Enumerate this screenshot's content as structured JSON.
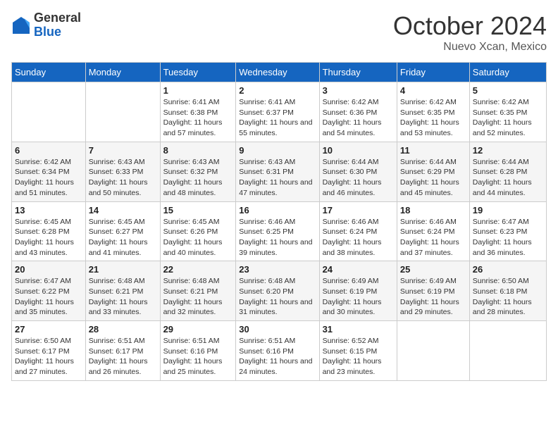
{
  "header": {
    "logo_general": "General",
    "logo_blue": "Blue",
    "month_title": "October 2024",
    "location": "Nuevo Xcan, Mexico"
  },
  "days_of_week": [
    "Sunday",
    "Monday",
    "Tuesday",
    "Wednesday",
    "Thursday",
    "Friday",
    "Saturday"
  ],
  "weeks": [
    [
      {
        "day": "",
        "info": ""
      },
      {
        "day": "",
        "info": ""
      },
      {
        "day": "1",
        "info": "Sunrise: 6:41 AM\nSunset: 6:38 PM\nDaylight: 11 hours and 57 minutes."
      },
      {
        "day": "2",
        "info": "Sunrise: 6:41 AM\nSunset: 6:37 PM\nDaylight: 11 hours and 55 minutes."
      },
      {
        "day": "3",
        "info": "Sunrise: 6:42 AM\nSunset: 6:36 PM\nDaylight: 11 hours and 54 minutes."
      },
      {
        "day": "4",
        "info": "Sunrise: 6:42 AM\nSunset: 6:35 PM\nDaylight: 11 hours and 53 minutes."
      },
      {
        "day": "5",
        "info": "Sunrise: 6:42 AM\nSunset: 6:35 PM\nDaylight: 11 hours and 52 minutes."
      }
    ],
    [
      {
        "day": "6",
        "info": "Sunrise: 6:42 AM\nSunset: 6:34 PM\nDaylight: 11 hours and 51 minutes."
      },
      {
        "day": "7",
        "info": "Sunrise: 6:43 AM\nSunset: 6:33 PM\nDaylight: 11 hours and 50 minutes."
      },
      {
        "day": "8",
        "info": "Sunrise: 6:43 AM\nSunset: 6:32 PM\nDaylight: 11 hours and 48 minutes."
      },
      {
        "day": "9",
        "info": "Sunrise: 6:43 AM\nSunset: 6:31 PM\nDaylight: 11 hours and 47 minutes."
      },
      {
        "day": "10",
        "info": "Sunrise: 6:44 AM\nSunset: 6:30 PM\nDaylight: 11 hours and 46 minutes."
      },
      {
        "day": "11",
        "info": "Sunrise: 6:44 AM\nSunset: 6:29 PM\nDaylight: 11 hours and 45 minutes."
      },
      {
        "day": "12",
        "info": "Sunrise: 6:44 AM\nSunset: 6:28 PM\nDaylight: 11 hours and 44 minutes."
      }
    ],
    [
      {
        "day": "13",
        "info": "Sunrise: 6:45 AM\nSunset: 6:28 PM\nDaylight: 11 hours and 43 minutes."
      },
      {
        "day": "14",
        "info": "Sunrise: 6:45 AM\nSunset: 6:27 PM\nDaylight: 11 hours and 41 minutes."
      },
      {
        "day": "15",
        "info": "Sunrise: 6:45 AM\nSunset: 6:26 PM\nDaylight: 11 hours and 40 minutes."
      },
      {
        "day": "16",
        "info": "Sunrise: 6:46 AM\nSunset: 6:25 PM\nDaylight: 11 hours and 39 minutes."
      },
      {
        "day": "17",
        "info": "Sunrise: 6:46 AM\nSunset: 6:24 PM\nDaylight: 11 hours and 38 minutes."
      },
      {
        "day": "18",
        "info": "Sunrise: 6:46 AM\nSunset: 6:24 PM\nDaylight: 11 hours and 37 minutes."
      },
      {
        "day": "19",
        "info": "Sunrise: 6:47 AM\nSunset: 6:23 PM\nDaylight: 11 hours and 36 minutes."
      }
    ],
    [
      {
        "day": "20",
        "info": "Sunrise: 6:47 AM\nSunset: 6:22 PM\nDaylight: 11 hours and 35 minutes."
      },
      {
        "day": "21",
        "info": "Sunrise: 6:48 AM\nSunset: 6:21 PM\nDaylight: 11 hours and 33 minutes."
      },
      {
        "day": "22",
        "info": "Sunrise: 6:48 AM\nSunset: 6:21 PM\nDaylight: 11 hours and 32 minutes."
      },
      {
        "day": "23",
        "info": "Sunrise: 6:48 AM\nSunset: 6:20 PM\nDaylight: 11 hours and 31 minutes."
      },
      {
        "day": "24",
        "info": "Sunrise: 6:49 AM\nSunset: 6:19 PM\nDaylight: 11 hours and 30 minutes."
      },
      {
        "day": "25",
        "info": "Sunrise: 6:49 AM\nSunset: 6:19 PM\nDaylight: 11 hours and 29 minutes."
      },
      {
        "day": "26",
        "info": "Sunrise: 6:50 AM\nSunset: 6:18 PM\nDaylight: 11 hours and 28 minutes."
      }
    ],
    [
      {
        "day": "27",
        "info": "Sunrise: 6:50 AM\nSunset: 6:17 PM\nDaylight: 11 hours and 27 minutes."
      },
      {
        "day": "28",
        "info": "Sunrise: 6:51 AM\nSunset: 6:17 PM\nDaylight: 11 hours and 26 minutes."
      },
      {
        "day": "29",
        "info": "Sunrise: 6:51 AM\nSunset: 6:16 PM\nDaylight: 11 hours and 25 minutes."
      },
      {
        "day": "30",
        "info": "Sunrise: 6:51 AM\nSunset: 6:16 PM\nDaylight: 11 hours and 24 minutes."
      },
      {
        "day": "31",
        "info": "Sunrise: 6:52 AM\nSunset: 6:15 PM\nDaylight: 11 hours and 23 minutes."
      },
      {
        "day": "",
        "info": ""
      },
      {
        "day": "",
        "info": ""
      }
    ]
  ]
}
